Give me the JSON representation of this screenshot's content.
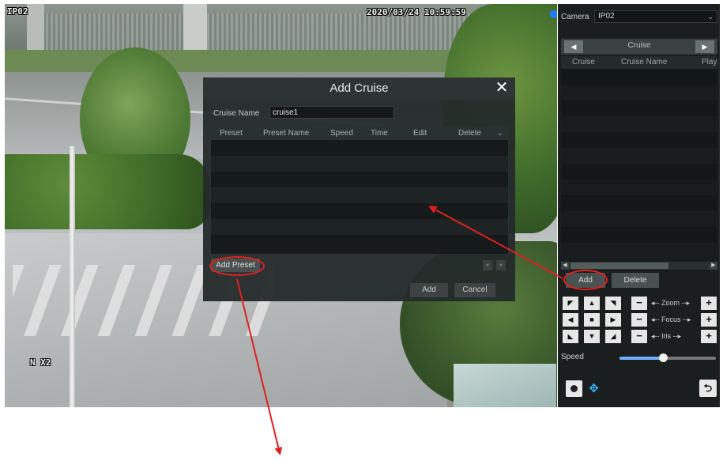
{
  "feed": {
    "camera_label": "IP02",
    "timestamp": "2020/03/24 10:59:59",
    "zoom_overlay": "N X2"
  },
  "dialog": {
    "title": "Add Cruise",
    "cruise_name_label": "Cruise Name",
    "cruise_name_value": "cruise1",
    "columns": [
      "Preset",
      "Preset Name",
      "Speed",
      "Time",
      "Edit",
      "Delete"
    ],
    "add_preset_label": "Add Preset",
    "add_label": "Add",
    "cancel_label": "Cancel",
    "close_icon": "close-icon",
    "page_prev": "«",
    "page_next": "»"
  },
  "panel": {
    "camera_label": "Camera",
    "camera_value": "IP02",
    "cruise_title": "Cruise",
    "columns": [
      "Cruise",
      "Cruise Name",
      "Play"
    ],
    "add_label": "Add",
    "delete_label": "Delete",
    "zoom_label": "Zoom",
    "focus_label": "Focus",
    "iris_label": "Iris",
    "speed_label": "Speed",
    "speed_level": 0.45
  },
  "annotations": {
    "highlight_color": "#e02020"
  }
}
